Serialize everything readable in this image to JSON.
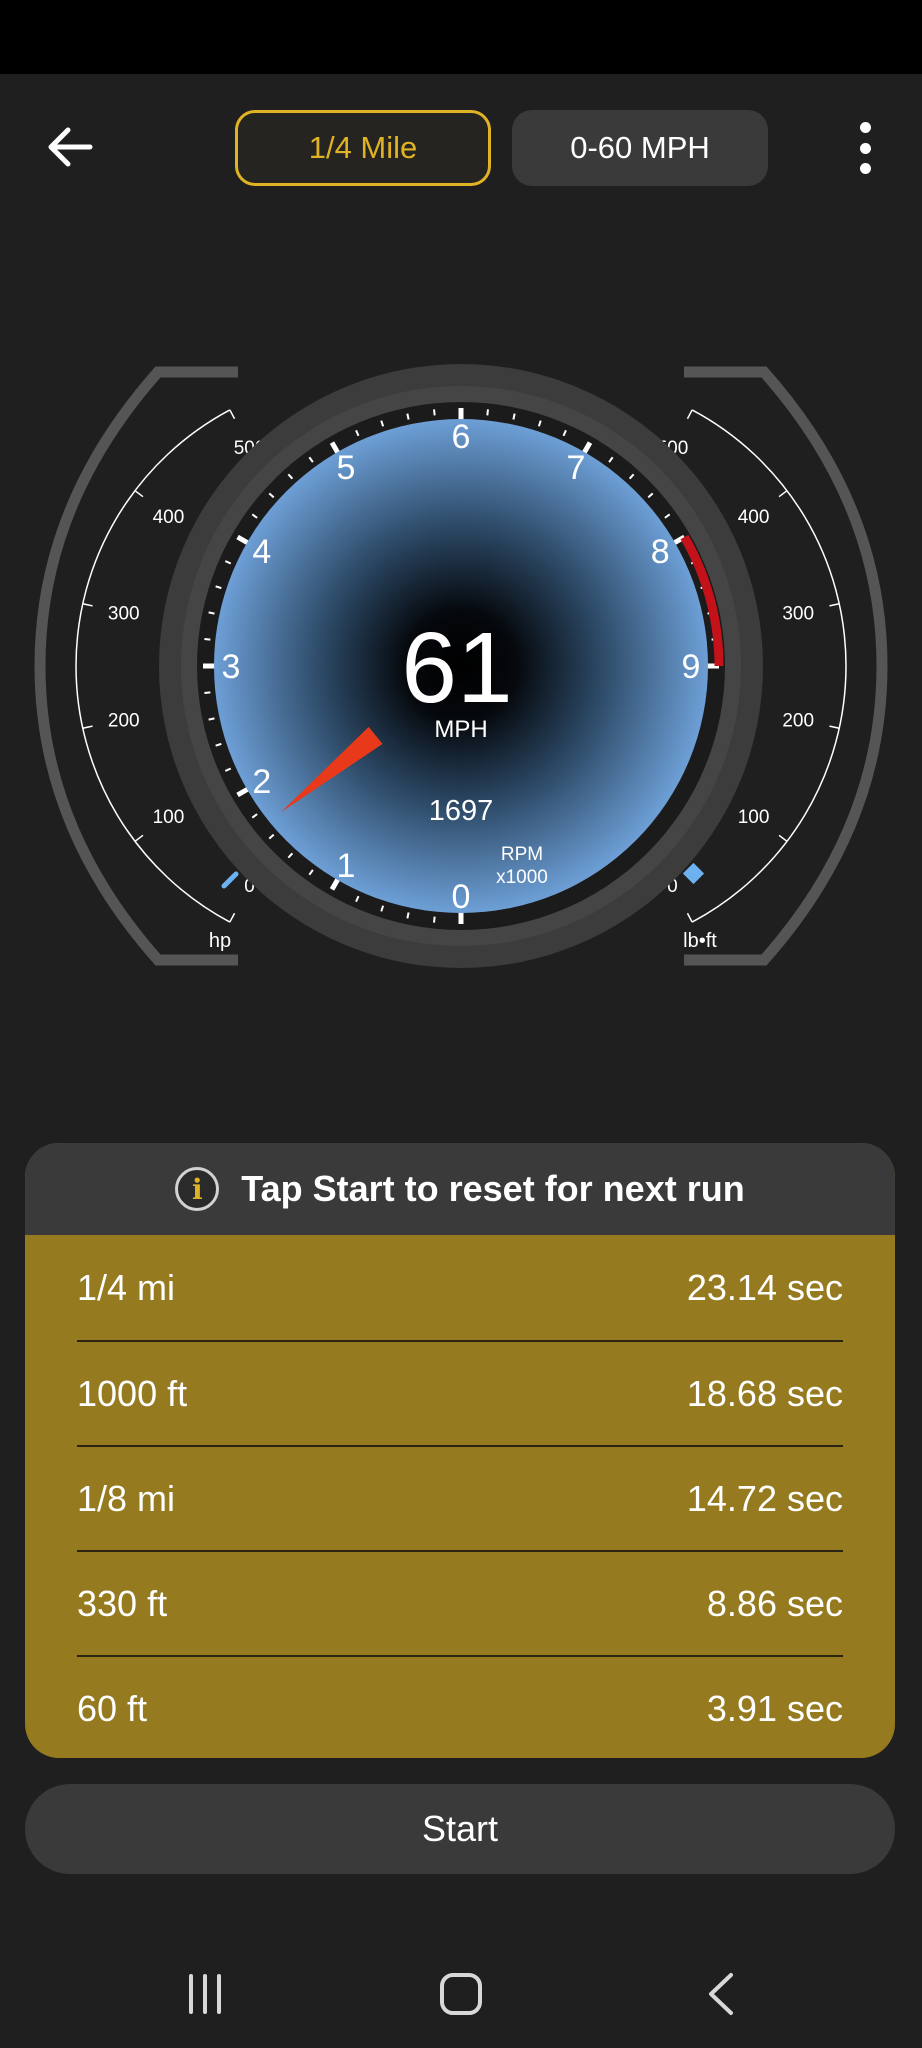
{
  "tabs": {
    "quarter_mile": "1/4 Mile",
    "zero_sixty": "0-60 MPH"
  },
  "gauge": {
    "speed_value": "61",
    "speed_unit": "MPH",
    "rpm_value": "1697",
    "rpm_label": "RPM",
    "rpm_scale_label": "x1000",
    "rpm_ticks": [
      "0",
      "1",
      "2",
      "3",
      "4",
      "5",
      "6",
      "7",
      "8",
      "9"
    ],
    "left_scale": {
      "labels": [
        "0",
        "100",
        "200",
        "300",
        "400",
        "500"
      ],
      "unit": "hp"
    },
    "right_scale": {
      "labels": [
        "0",
        "100",
        "200",
        "300",
        "400",
        "500"
      ],
      "unit": "lb•ft"
    },
    "needle_rpm": 1.697,
    "colors": {
      "accent": "#e0b324",
      "needle": "#e8391a",
      "redline": "#c4121a",
      "dial": "#5e8fc7",
      "marker": "#6cb2f0"
    }
  },
  "info": {
    "message": "Tap Start to reset for next run",
    "rows": [
      {
        "label": "1/4 mi",
        "value": "23.14 sec"
      },
      {
        "label": "1000 ft",
        "value": "18.68 sec"
      },
      {
        "label": "1/8 mi",
        "value": "14.72 sec"
      },
      {
        "label": "330 ft",
        "value": "8.86 sec"
      },
      {
        "label": "60 ft",
        "value": "3.91 sec"
      }
    ]
  },
  "start_label": "Start",
  "icons": {
    "back": "arrow-left-icon",
    "menu": "more-vertical-icon",
    "info": "info-icon",
    "nav_recents": "recents-icon",
    "nav_home": "home-icon",
    "nav_back": "chevron-left-icon"
  }
}
